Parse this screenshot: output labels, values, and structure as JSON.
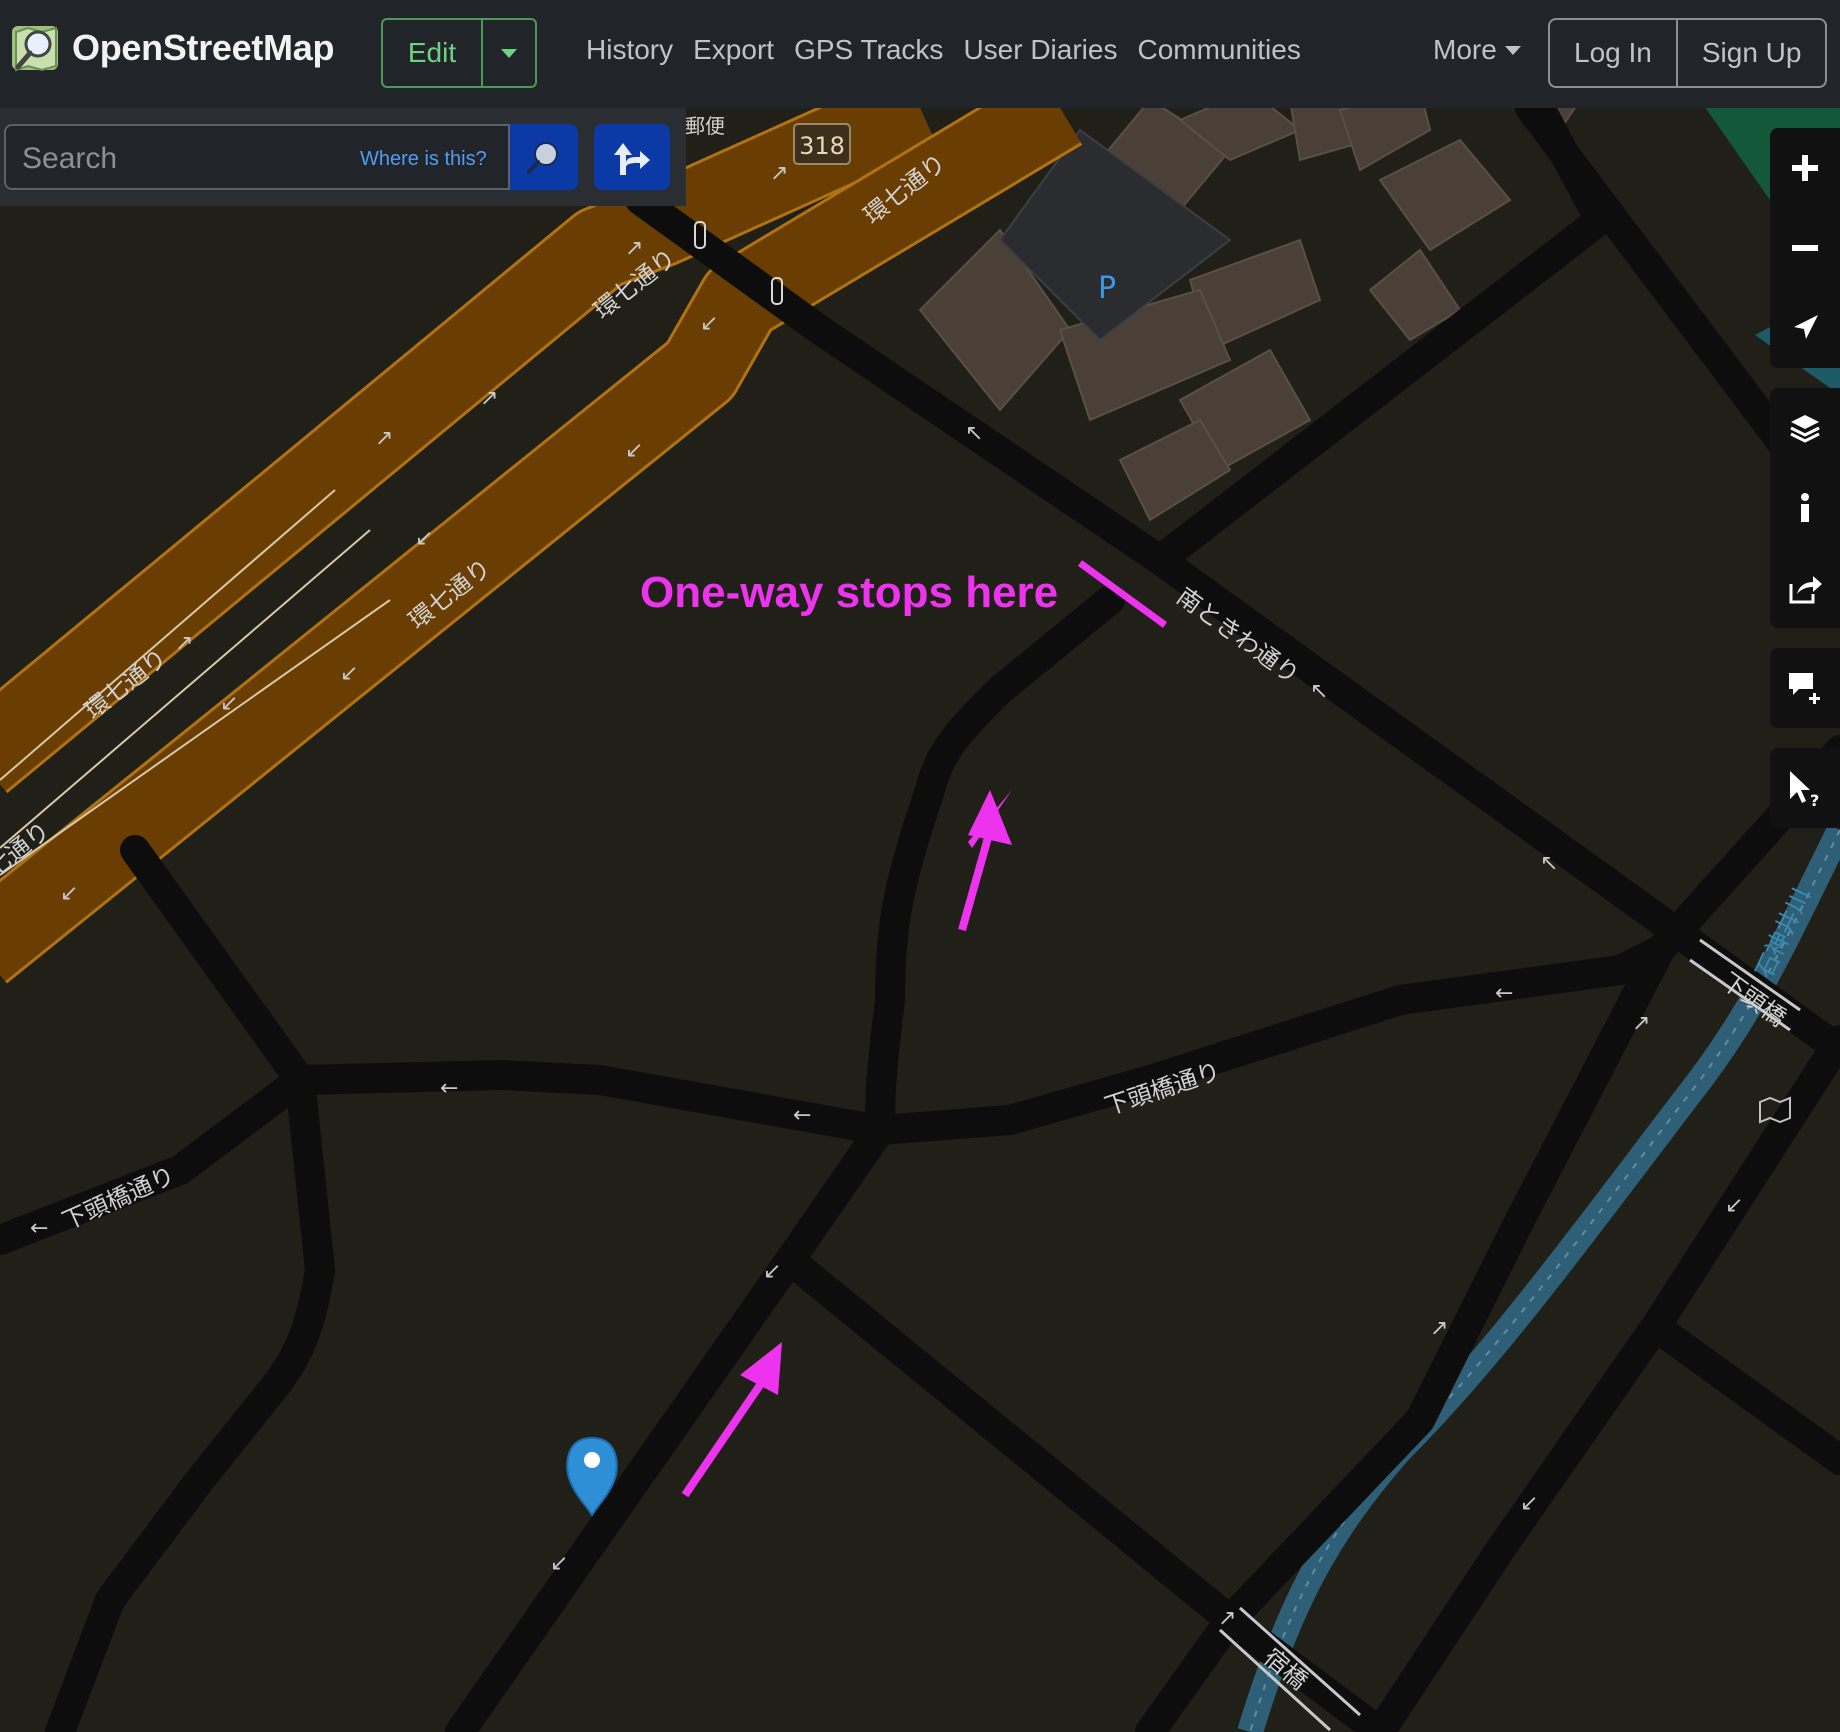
{
  "header": {
    "brand": "OpenStreetMap",
    "edit_label": "Edit",
    "nav": [
      "History",
      "Export",
      "GPS Tracks",
      "User Diaries",
      "Communities"
    ],
    "more_label": "More",
    "login_label": "Log In",
    "signup_label": "Sign Up"
  },
  "search": {
    "placeholder": "Search",
    "where_link": "Where is this?"
  },
  "map": {
    "labels": {
      "route_shield": "318",
      "kan7_a": "環七通り",
      "kan7_b": "環七通り",
      "kan7_c": "環七通り",
      "kan7_d": "環七通り",
      "kan7_e": "環七通り",
      "kan7_f": "七通り",
      "tokiwa": "南ときわ通り",
      "shimo_a": "下頭橋通り",
      "shimo_b": "下頭橋通り",
      "shimo_bridge": "下頭橋",
      "shuku_bridge": "宿橋",
      "river": "石神井川",
      "post": "郵便",
      "parking": "P"
    },
    "annotation": "One-way stops here"
  },
  "colors": {
    "header_bg": "#212529",
    "map_bg": "#201f18",
    "road_dark": "#0d0d0d",
    "trunk": "#6a3e03",
    "trunk_border": "#b07212",
    "building": "#4a4038",
    "river": "#2e5f77",
    "annotation": "#ee33ee",
    "marker": "#2f8fd6",
    "accent_green": "#6fd27e"
  },
  "icons": [
    "osm-logo-icon",
    "search-icon",
    "directions-icon",
    "zoom-in-icon",
    "zoom-out-icon",
    "locate-icon",
    "layers-icon",
    "info-icon",
    "share-icon",
    "add-note-icon",
    "query-features-icon",
    "map-marker-icon"
  ]
}
